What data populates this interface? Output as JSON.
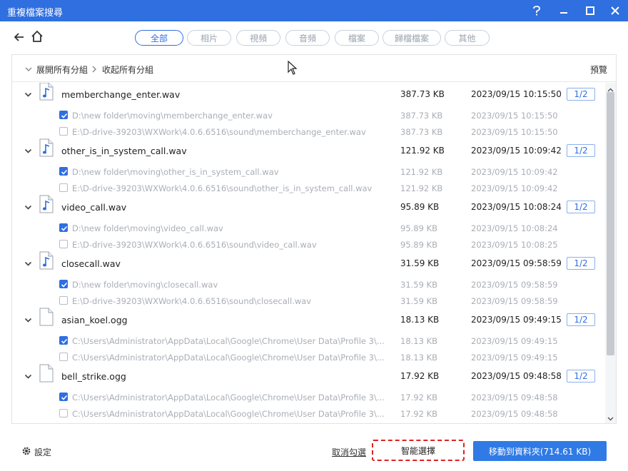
{
  "window": {
    "title": "重複檔案搜尋"
  },
  "tabs": [
    {
      "label": "全部",
      "active": true
    },
    {
      "label": "相片",
      "active": false
    },
    {
      "label": "視頻",
      "active": false
    },
    {
      "label": "音頻",
      "active": false
    },
    {
      "label": "檔案",
      "active": false
    },
    {
      "label": "歸檔檔案",
      "active": false
    },
    {
      "label": "其他",
      "active": false
    }
  ],
  "panel": {
    "expand_all": "展開所有分組",
    "collapse_all": "收起所有分組",
    "preview": "預覽"
  },
  "groups": [
    {
      "name": "memberchange_enter.wav",
      "size": "387.73 KB",
      "date": "2023/09/15 10:15:50",
      "badge": "1/2",
      "icon": "audio-file-icon",
      "copies": [
        {
          "checked": true,
          "path": "D:\\new folder\\moving\\memberchange_enter.wav",
          "size": "387.73 KB",
          "date": "2023/09/15 10:15:50"
        },
        {
          "checked": false,
          "path": "E:\\D-drive-39203\\WXWork\\4.0.6.6516\\sound\\memberchange_enter.wav",
          "size": "387.73 KB",
          "date": "2023/09/15 10:15:50"
        }
      ]
    },
    {
      "name": "other_is_in_system_call.wav",
      "size": "121.92 KB",
      "date": "2023/09/15 10:09:42",
      "badge": "1/2",
      "icon": "audio-file-icon",
      "copies": [
        {
          "checked": true,
          "path": "D:\\new folder\\moving\\other_is_in_system_call.wav",
          "size": "121.92 KB",
          "date": "2023/09/15 10:09:42"
        },
        {
          "checked": false,
          "path": "E:\\D-drive-39203\\WXWork\\4.0.6.6516\\sound\\other_is_in_system_call.wav",
          "size": "121.92 KB",
          "date": "2023/09/15 10:09:42"
        }
      ]
    },
    {
      "name": "video_call.wav",
      "size": "95.89 KB",
      "date": "2023/09/15 10:08:24",
      "badge": "1/2",
      "icon": "audio-file-icon",
      "copies": [
        {
          "checked": true,
          "path": "D:\\new folder\\moving\\video_call.wav",
          "size": "95.89 KB",
          "date": "2023/09/15 10:08:24"
        },
        {
          "checked": false,
          "path": "E:\\D-drive-39203\\WXWork\\4.0.6.6516\\sound\\video_call.wav",
          "size": "95.89 KB",
          "date": "2023/09/15 10:08:25"
        }
      ]
    },
    {
      "name": "closecall.wav",
      "size": "31.59 KB",
      "date": "2023/09/15 09:58:59",
      "badge": "1/2",
      "icon": "audio-file-icon",
      "copies": [
        {
          "checked": true,
          "path": "D:\\new folder\\moving\\closecall.wav",
          "size": "31.59 KB",
          "date": "2023/09/15 09:58:59"
        },
        {
          "checked": false,
          "path": "E:\\D-drive-39203\\WXWork\\4.0.6.6516\\sound\\closecall.wav",
          "size": "31.59 KB",
          "date": "2023/09/15 09:58:59"
        }
      ]
    },
    {
      "name": "asian_koel.ogg",
      "size": "18.13 KB",
      "date": "2023/09/15 09:49:15",
      "badge": "1/2",
      "icon": "blank-file-icon",
      "copies": [
        {
          "checked": true,
          "path": "C:\\Users\\Administrator\\AppData\\Local\\Google\\Chrome\\User Data\\Profile 3\\...",
          "size": "18.13 KB",
          "date": "2023/09/15 09:49:15"
        },
        {
          "checked": false,
          "path": "C:\\Users\\Administrator\\AppData\\Local\\Google\\Chrome\\User Data\\Profile 3\\...",
          "size": "18.13 KB",
          "date": "2023/09/15 09:49:15"
        }
      ]
    },
    {
      "name": "bell_strike.ogg",
      "size": "17.92 KB",
      "date": "2023/09/15 09:48:58",
      "badge": "1/2",
      "icon": "blank-file-icon",
      "copies": [
        {
          "checked": true,
          "path": "C:\\Users\\Administrator\\AppData\\Local\\Google\\Chrome\\User Data\\Profile 3\\...",
          "size": "17.92 KB",
          "date": "2023/09/15 09:48:58"
        },
        {
          "checked": false,
          "path": "C:\\Users\\Administrator\\AppData\\Local\\Google\\Chrome\\User Data\\Profile 3\\...",
          "size": "17.92 KB",
          "date": "2023/09/15 09:48:58"
        }
      ]
    }
  ],
  "footer": {
    "settings": "設定",
    "uncheck": "取消勾選",
    "smart_select": "智能選擇",
    "move_to_folder": "移動到資料夾(714.61 KB)"
  },
  "colors": {
    "accent": "#2f6fe0",
    "highlight": "#e02020"
  }
}
